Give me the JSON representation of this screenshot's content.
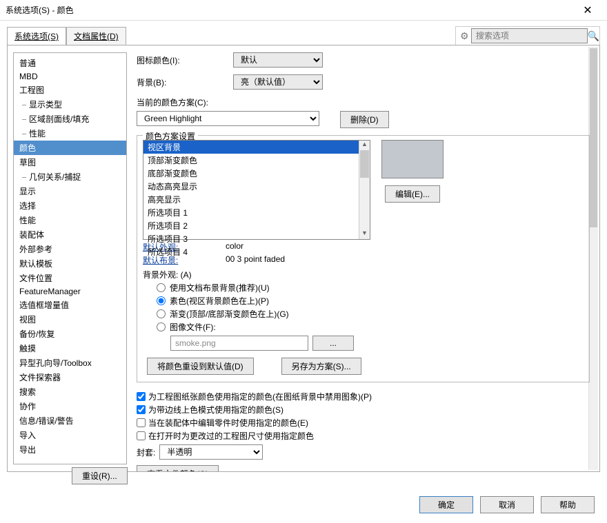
{
  "window": {
    "title": "系统选项(S) - 颜色"
  },
  "tabs": {
    "system": "系统选项(S)",
    "docprops": "文档属性(D)"
  },
  "search": {
    "placeholder": "搜索选项"
  },
  "sidebar": {
    "items": [
      {
        "label": "普通"
      },
      {
        "label": "MBD"
      },
      {
        "label": "工程图"
      },
      {
        "label": "显示类型",
        "child": true
      },
      {
        "label": "区域剖面线/填充",
        "child": true
      },
      {
        "label": "性能",
        "child": true
      },
      {
        "label": "颜色",
        "selected": true
      },
      {
        "label": "草图"
      },
      {
        "label": "几何关系/捕捉",
        "child": true
      },
      {
        "label": "显示"
      },
      {
        "label": "选择"
      },
      {
        "label": "性能"
      },
      {
        "label": "装配体"
      },
      {
        "label": "外部参考"
      },
      {
        "label": "默认模板"
      },
      {
        "label": "文件位置"
      },
      {
        "label": "FeatureManager"
      },
      {
        "label": "选值框增量值"
      },
      {
        "label": "视图"
      },
      {
        "label": "备份/恢复"
      },
      {
        "label": "触摸"
      },
      {
        "label": "异型孔向导/Toolbox"
      },
      {
        "label": "文件探索器"
      },
      {
        "label": "搜索"
      },
      {
        "label": "协作"
      },
      {
        "label": "信息/错误/警告"
      },
      {
        "label": "导入"
      },
      {
        "label": "导出"
      }
    ]
  },
  "panel": {
    "iconColorLabel": "图标颜色(I):",
    "iconColorValue": "默认",
    "backgroundLabel": "背景(B):",
    "backgroundValue": "亮（默认值）",
    "schemeLabel": "当前的颜色方案(C):",
    "schemeValue": "Green Highlight",
    "deleteBtn": "删除(D)",
    "fieldsetTitle": "颜色方案设置",
    "schemeList": [
      "视区背景",
      "顶部渐变颜色",
      "底部渐变颜色",
      "动态高亮显示",
      "高亮显示",
      "所选项目 1",
      "所选项目 2",
      "所选项目 3",
      "所选项目 4"
    ],
    "editBtn": "编辑(E)...",
    "defaultAppearance": "默认外观:",
    "defaultAppearanceVal": "color",
    "defaultLayout": "默认布景:",
    "defaultLayoutVal": "00 3 point faded",
    "bgAppearance": "背景外观:   (A)",
    "radios": [
      "使用文档布景背景(推荐)(U)",
      "素色(视区背景颜色在上)(P)",
      "渐变(顶部/底部渐变颜色在上)(G)",
      "图像文件(F):"
    ],
    "imageFile": "smoke.png",
    "resetColorsBtn": "将颜色重设到默认值(D)",
    "saveSchemeBtn": "另存为方案(S)...",
    "checks": [
      "为工程图纸张颜色使用指定的颜色(在图纸背景中禁用图象)(P)",
      "为带边线上色模式使用指定的颜色(S)",
      "当在装配体中编辑零件时使用指定的颜色(E)",
      "在打开时为更改过的工程图尺寸使用指定颜色"
    ],
    "envelopeLabel": "封套:",
    "envelopeValue": "半透明",
    "viewFileColorsBtn": "查看文件颜色(G)"
  },
  "bottom": {
    "reset": "重设(R)...",
    "ok": "确定",
    "cancel": "取消",
    "help": "帮助"
  }
}
